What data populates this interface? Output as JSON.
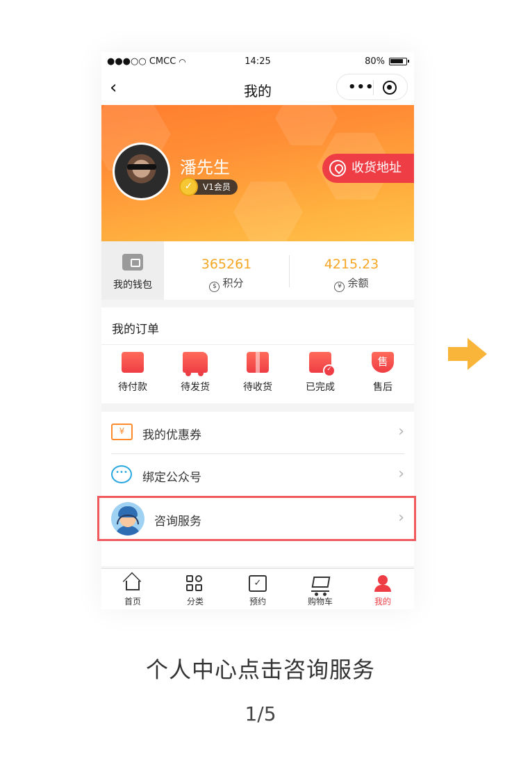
{
  "status_bar": {
    "carrier": "●●●○○ CMCC",
    "time": "14:25",
    "battery": "80%"
  },
  "navbar": {
    "back": "‹",
    "title": "我的",
    "more": "•••"
  },
  "profile": {
    "name": "潘先生",
    "badge_mark": "✓",
    "level": "V1会员",
    "address_button": "收货地址"
  },
  "wallet": {
    "label": "我的钱包",
    "points": {
      "value": "365261",
      "label": "积分",
      "icon": "$"
    },
    "balance": {
      "value": "4215.23",
      "label": "余额",
      "icon": "¥"
    }
  },
  "orders": {
    "title": "我的订单",
    "items": [
      {
        "label": "待付款",
        "icon": "wallet-icon"
      },
      {
        "label": "待发货",
        "icon": "truck-icon"
      },
      {
        "label": "待收货",
        "icon": "package-icon"
      },
      {
        "label": "已完成",
        "icon": "completed-icon"
      },
      {
        "label": "售后",
        "icon": "after-sale-icon",
        "glyph": "售"
      }
    ]
  },
  "menu": [
    {
      "label": "我的优惠券",
      "icon": "coupon-icon",
      "glyph": "¥"
    },
    {
      "label": "绑定公众号",
      "icon": "wechat-icon",
      "glyph": "•••"
    },
    {
      "label": "咨询服务",
      "icon": "customer-service-icon"
    }
  ],
  "tabbar": [
    {
      "label": "首页",
      "icon": "home-icon"
    },
    {
      "label": "分类",
      "icon": "category-icon"
    },
    {
      "label": "预约",
      "icon": "calendar-check-icon",
      "glyph": "✓"
    },
    {
      "label": "购物车",
      "icon": "cart-icon"
    },
    {
      "label": "我的",
      "icon": "user-icon",
      "active": true
    }
  ],
  "caption": "个人中心点击咨询服务",
  "pager": "1/5",
  "colors": {
    "accent": "#ee3d44",
    "orange": "#ff8a2b",
    "gold": "#f5a623",
    "arrow": "#f9b53a"
  }
}
